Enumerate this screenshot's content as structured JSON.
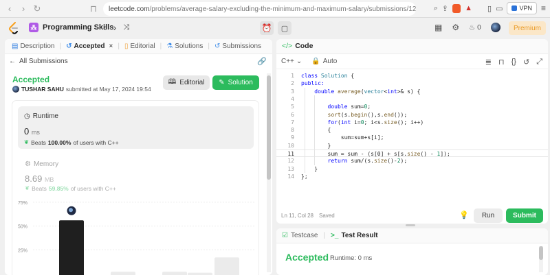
{
  "browser": {
    "url_host": "leetcode.com",
    "url_path": "/problems/average-salary-excluding-the-minimum-and-maximum-salary/submissions/12605...",
    "vpn_label": "VPN"
  },
  "header": {
    "title": "Programming Skills",
    "points": "0",
    "premium": "Premium"
  },
  "left_tabs": [
    {
      "label": "Description"
    },
    {
      "label": "Accepted"
    },
    {
      "label": "Editorial"
    },
    {
      "label": "Solutions"
    },
    {
      "label": "Submissions"
    }
  ],
  "submission": {
    "back_link": "All Submissions",
    "status": "Accepted",
    "user": "TUSHAR SAHU",
    "submitted_text": "submitted at May 17, 2024 19:54",
    "editorial_btn": "Editorial",
    "solution_btn": "Solution"
  },
  "runtime": {
    "label": "Runtime",
    "value": "0",
    "unit": "ms",
    "beats_prefix": "Beats",
    "beats_pct": "100.00%",
    "beats_suffix": "of users with C++"
  },
  "memory": {
    "label": "Memory",
    "value": "8.69",
    "unit": "MB",
    "beats_prefix": "Beats",
    "beats_pct": "59.85%",
    "beats_suffix": "of users with C++"
  },
  "chart_data": {
    "type": "bar",
    "title": "",
    "xlabel": "",
    "ylabel": "",
    "y_ticks": [
      "75%",
      "50%",
      "25%"
    ],
    "ylim": [
      0,
      85
    ],
    "values": [
      56,
      2,
      2,
      1,
      17
    ],
    "highlight_index": 0,
    "highlight_color": "#1f1f1f",
    "base_color": "#ebebeb",
    "grid": true
  },
  "code_panel": {
    "tab_label": "Code",
    "language": "C++",
    "mode": "Auto",
    "status": "Ln 11, Col 28",
    "saved": "Saved",
    "run": "Run",
    "submit": "Submit"
  },
  "code_lines": [
    "class Solution {",
    "public:",
    "    double average(vector<int>& s) {",
    "",
    "        double sum=0;",
    "        sort(s.begin(),s.end());",
    "        for(int i=0; i<s.size(); i++)",
    "        {",
    "            sum=sum+s[i];",
    "        }",
    "        sum = sum - (s[0] + s[s.size() - 1]);",
    "        return sum/(s.size()-2);",
    "    }",
    "};"
  ],
  "bottom_panel": {
    "testcase_tab": "Testcase",
    "result_tab": "Test Result",
    "result_status": "Accepted",
    "result_runtime": "Runtime: 0 ms"
  }
}
